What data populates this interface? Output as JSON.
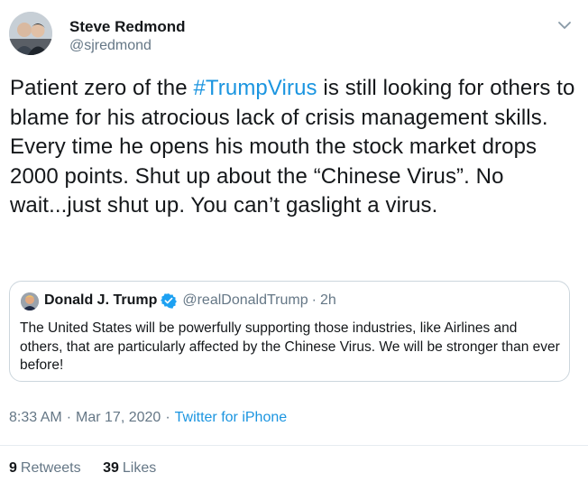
{
  "author": {
    "name": "Steve Redmond",
    "handle": "@sjredmond"
  },
  "tweet": {
    "text_before": "Patient zero of the ",
    "hashtag": "#TrumpVirus",
    "text_after": " is still  looking for others to blame for his atrocious lack of crisis management skills. Every time he opens his mouth the stock market drops 2000 points. Shut up about the “Chinese Virus”. No wait...just shut up. You can’t gaslight a virus."
  },
  "quote": {
    "name": "Donald J. Trump",
    "handle": "@realDonaldTrump",
    "dot": "·",
    "time": "2h",
    "text": "The United States will be powerfully supporting those industries, like Airlines and others, that are particularly affected by the Chinese Virus. We will be stronger than ever before!"
  },
  "meta": {
    "time": "8:33 AM",
    "sep1": "·",
    "date": "Mar 17, 2020",
    "sep2": "·",
    "source": "Twitter for iPhone"
  },
  "stats": {
    "retweets_count": "9",
    "retweets_label": "Retweets",
    "likes_count": "39",
    "likes_label": "Likes"
  },
  "icons": {
    "caret": "chevron-down-icon",
    "verified": "verified-badge-icon"
  },
  "colors": {
    "link": "#1b95e0",
    "secondary_text": "#657786",
    "border": "#ccd6dd",
    "verified": "#1da1f2"
  }
}
